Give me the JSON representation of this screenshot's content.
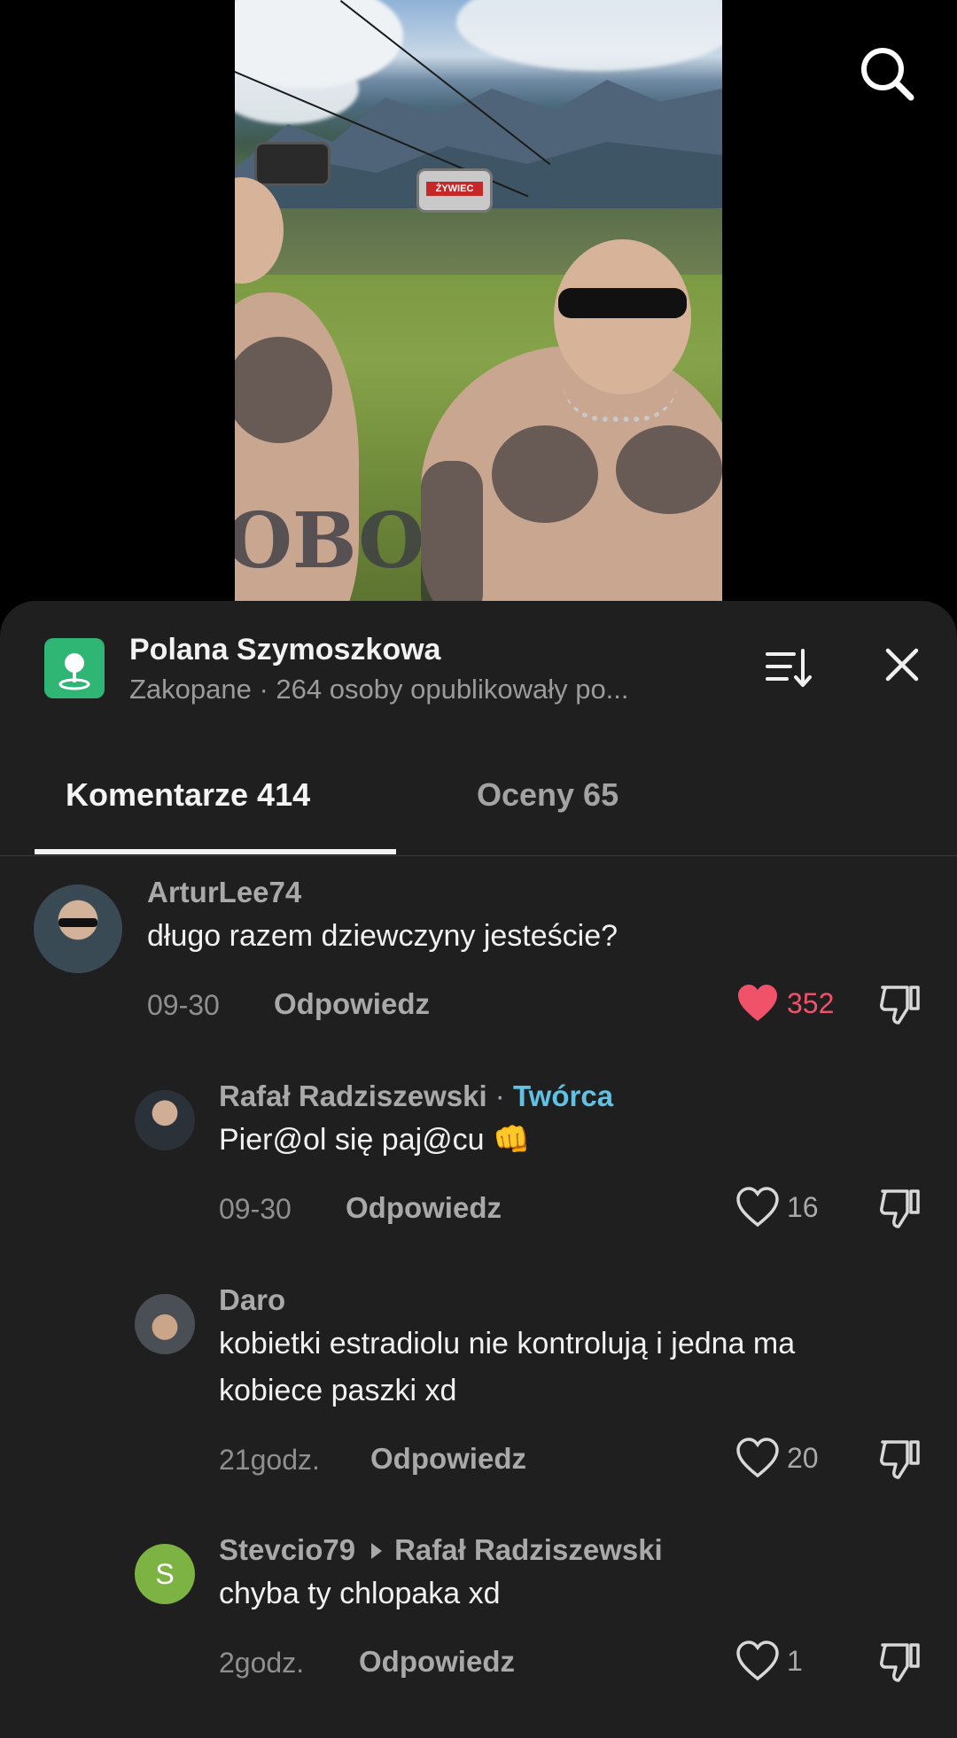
{
  "location": {
    "title": "Polana Szymoszkowa",
    "subtitle": "Zakopane · 264 osoby opublikowały po...",
    "icon": "location-pin-icon",
    "accent": "#2fb574"
  },
  "tabs": [
    {
      "label": "Komentarze 414",
      "active": true
    },
    {
      "label": "Oceny 65",
      "active": false
    }
  ],
  "video": {
    "gondola_sign": "ŻYWIEC"
  },
  "comments": [
    {
      "username": "ArturLee74",
      "text": "długo razem dziewczyny jesteście?",
      "date": "09-30",
      "reply_label": "Odpowiedz",
      "likes": "352",
      "liked": true
    },
    {
      "username": "Rafał Radziszewski",
      "separator": "·",
      "badge": "Twórca",
      "text": "Pier@ol się paj@cu 👊",
      "date": "09-30",
      "reply_label": "Odpowiedz",
      "likes": "16",
      "liked": false
    },
    {
      "username": "Daro",
      "text_line1": "kobietki estradiolu nie kontrolują i jedna ma",
      "text_line2": "kobiece paszki xd",
      "date": "21godz.",
      "reply_label": "Odpowiedz",
      "likes": "20",
      "liked": false
    },
    {
      "username": "Stevcio79",
      "reply_to": "Rafał Radziszewski",
      "avatar_letter": "S",
      "avatar_color": "#7cb342",
      "text": "chyba ty chlopaka xd",
      "date": "2godz.",
      "reply_label": "Odpowiedz",
      "likes": "1",
      "liked": false
    }
  ],
  "colors": {
    "like_red": "#f0526a",
    "creator_blue": "#5fc2e4",
    "sheet_bg": "#1f1f1f"
  }
}
